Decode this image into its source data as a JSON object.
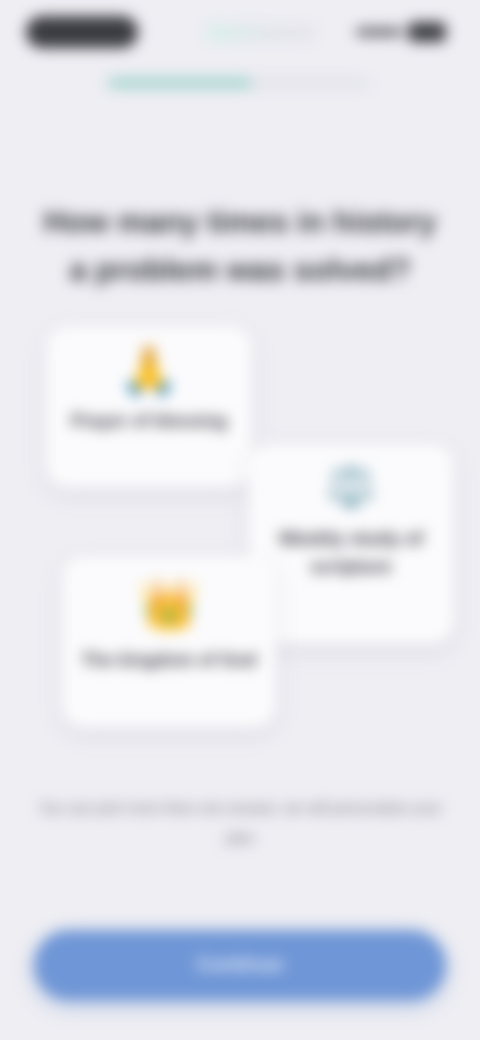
{
  "progress": {
    "fraction": 0.55
  },
  "heading": {
    "title": "How many times in history a problem was solved?"
  },
  "options": [
    {
      "emoji": "🙏",
      "label": "Prayer of blessing"
    },
    {
      "emoji": "⚖️",
      "label": "Weekly study of scripture"
    },
    {
      "emoji": "👑",
      "label": "The kingdom of God"
    }
  ],
  "footer": {
    "note": "You can pick more than one answer, we will personalize your plan"
  },
  "cta": {
    "label": "Continue"
  },
  "colors": {
    "background": "#eeeef3",
    "accent": "#6f96d6",
    "progress": "#9fd2cc"
  }
}
